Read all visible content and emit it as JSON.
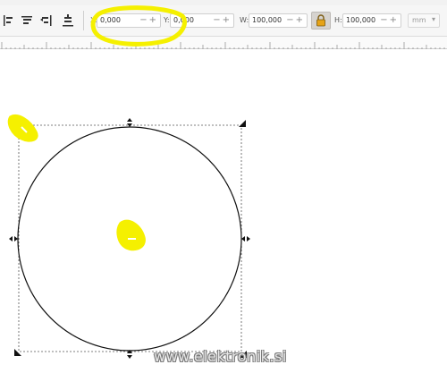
{
  "toolbar": {
    "x_label": "X:",
    "x_value": "0,000",
    "y_label": "Y:",
    "y_value": "0,000",
    "w_label": "W:",
    "w_value": "100,000",
    "h_label": "H:",
    "h_value": "100,000",
    "unit": "mm",
    "pm_glyph": "−+"
  },
  "icons": [
    "align-left-icon",
    "align-center-icon",
    "align-right-icon",
    "align-bottom-icon",
    "lock-icon",
    "dropdown-arrow-icon"
  ],
  "canvas": {
    "watermark": "www.elektronik.si"
  },
  "colors": {
    "highlight": "#f5f000",
    "lock_button": "#d6d3cf",
    "selection_dash": "#555555"
  }
}
